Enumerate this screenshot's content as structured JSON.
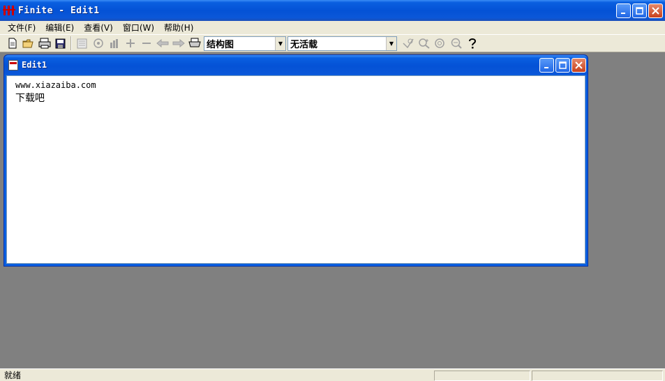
{
  "window": {
    "title": "Finite - Edit1"
  },
  "menu": [
    {
      "label": "文件(F)"
    },
    {
      "label": "编辑(E)"
    },
    {
      "label": "查看(V)"
    },
    {
      "label": "窗口(W)"
    },
    {
      "label": "帮助(H)"
    }
  ],
  "toolbar": {
    "combo1_value": "结构图",
    "combo2_value": "无活载",
    "icons": [
      "new-file-icon",
      "open-folder-icon",
      "print-icon",
      "save-icon",
      "doc-icon",
      "view-icon",
      "chart-icon",
      "plus-icon",
      "minus-icon",
      "arrow-left-icon",
      "arrow-right-icon",
      "printer-icon",
      "select-icon",
      "zoom-in-icon",
      "zoom-reset-icon",
      "zoom-out-icon",
      "help-icon"
    ]
  },
  "child_window": {
    "title": "Edit1",
    "content": [
      "www.xiazaiba.com",
      "下载吧"
    ]
  },
  "statusbar": {
    "text": "就绪"
  },
  "colors": {
    "titlebar": "#0a5fe0",
    "chrome": "#ece9d8",
    "workspace": "#808080"
  }
}
